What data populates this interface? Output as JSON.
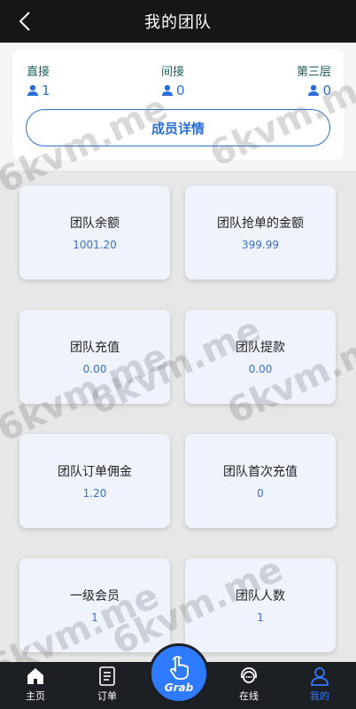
{
  "header": {
    "title": "我的团队"
  },
  "stats": [
    {
      "label": "直接",
      "value": "1"
    },
    {
      "label": "间接",
      "value": "0"
    },
    {
      "label": "第三层",
      "value": "0"
    }
  ],
  "detail_button": "成员详情",
  "tiles": [
    {
      "label": "团队余额",
      "value": "1001.20"
    },
    {
      "label": "团队抢单的金额",
      "value": "399.99"
    },
    {
      "label": "团队充值",
      "value": "0.00"
    },
    {
      "label": "团队提款",
      "value": "0.00"
    },
    {
      "label": "团队订单佣金",
      "value": "1.20"
    },
    {
      "label": "团队首次充值",
      "value": "0"
    },
    {
      "label": "一级会员",
      "value": "1"
    },
    {
      "label": "团队人数",
      "value": "1"
    }
  ],
  "watermark": "6kvm.me",
  "tabbar": {
    "home": "主页",
    "orders": "订单",
    "grab": "Grab",
    "online": "在线",
    "mine": "我的"
  },
  "colors": {
    "accent": "#2f7bff",
    "header_bg": "#161616",
    "tabbar_bg": "#1c1f24",
    "tile_bg": "#eef3fc"
  }
}
